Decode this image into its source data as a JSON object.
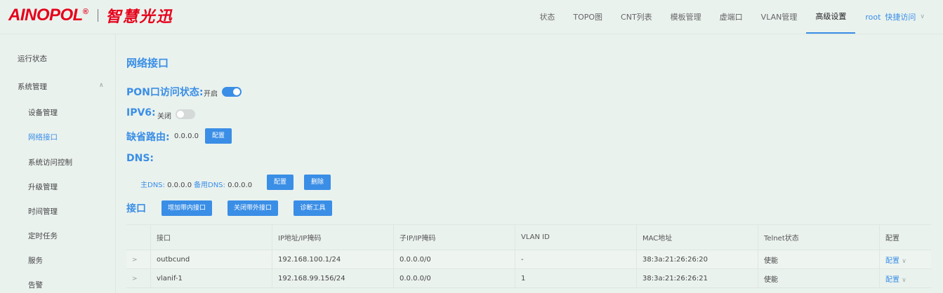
{
  "brand": {
    "logo_text": "AINOPOL",
    "logo_reg": "®",
    "logo_cn": "智慧光迅"
  },
  "nav": {
    "items": [
      "状态",
      "TOPO图",
      "CNT列表",
      "模板管理",
      "虚端口",
      "VLAN管理",
      "高级设置"
    ],
    "active": "高级设置",
    "user": "root",
    "quick_access": "快捷访问"
  },
  "sidebar": {
    "items": [
      {
        "label": "运行状态"
      },
      {
        "label": "系统管理"
      },
      {
        "label": "设备管理"
      },
      {
        "label": "网络接口"
      },
      {
        "label": "系统访问控制"
      },
      {
        "label": "升级管理"
      },
      {
        "label": "时间管理"
      },
      {
        "label": "定时任务"
      },
      {
        "label": "服务"
      },
      {
        "label": "告警"
      }
    ],
    "active": "网络接口"
  },
  "main": {
    "title": "网络接口",
    "pon": {
      "label": "PON口访问状态:",
      "state": "开启",
      "enabled": true
    },
    "ipv6": {
      "label": "IPV6:",
      "state": "关闭",
      "enabled": false
    },
    "gateway": {
      "label": "缺省路由:",
      "value": "0.0.0.0",
      "button": "配置"
    },
    "dns": {
      "label": "DNS:",
      "primary_label": "主DNS:",
      "primary": "0.0.0.0",
      "secondary_label": "备用DNS:",
      "secondary": "0.0.0.0",
      "config_button": "配置",
      "delete_button": "删除"
    },
    "interfaces": {
      "label": "接口",
      "buttons": [
        "增加带内接口",
        "关闭带外接口",
        "诊断工具"
      ]
    }
  },
  "table": {
    "headers": [
      "",
      "接口",
      "IP地址/IP掩码",
      "子IP/IP掩码",
      "VLAN ID",
      "MAC地址",
      "Telnet状态",
      "配置"
    ],
    "rows": [
      {
        "iface": "outbcund",
        "ip": "192.168.100.1/24",
        "sub": "0.0.0.0/0",
        "vlan": "-",
        "mac": "38:3a:21:26:26:20",
        "telnet": "使能",
        "action": "配置"
      },
      {
        "iface": "vlanif-1",
        "ip": "192.168.99.156/24",
        "sub": "0.0.0.0/0",
        "vlan": "1",
        "mac": "38:3a:21:26:26:21",
        "telnet": "使能",
        "action": "配置"
      }
    ]
  }
}
